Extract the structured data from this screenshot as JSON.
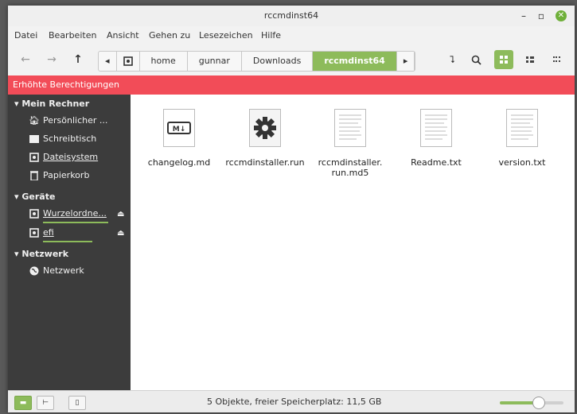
{
  "window": {
    "title": "rccmdinst64"
  },
  "menu": [
    "Datei",
    "Bearbeiten",
    "Ansicht",
    "Gehen zu",
    "Lesezeichen",
    "Hilfe"
  ],
  "breadcrumbs": [
    "home",
    "gunnar",
    "Downloads",
    "rccmdinst64"
  ],
  "banner": "Erhöhte Berechtigungen",
  "sidebar": {
    "sections": [
      {
        "title": "Mein Rechner",
        "items": [
          {
            "label": "Persönlicher ...",
            "icon": "home-icon"
          },
          {
            "label": "Schreibtisch",
            "icon": "desktop-icon"
          },
          {
            "label": "Dateisystem",
            "icon": "drive-icon"
          },
          {
            "label": "Papierkorb",
            "icon": "trash-icon"
          }
        ]
      },
      {
        "title": "Geräte",
        "items": [
          {
            "label": "Wurzelordne...",
            "icon": "drive-icon"
          },
          {
            "label": "efi",
            "icon": "drive-icon"
          }
        ]
      },
      {
        "title": "Netzwerk",
        "items": [
          {
            "label": "Netzwerk",
            "icon": "network-icon"
          }
        ]
      }
    ]
  },
  "files": [
    {
      "name": "changelog.md",
      "icon": "markdown-icon"
    },
    {
      "name": "rccmdinstaller.run",
      "icon": "gear-icon"
    },
    {
      "name": "rccmdinstaller.\nrun.md5",
      "icon": "text-file-icon"
    },
    {
      "name": "Readme.txt",
      "icon": "text-file-icon"
    },
    {
      "name": "version.txt",
      "icon": "text-file-icon"
    }
  ],
  "status": {
    "text": "5 Objekte, freier Speicherplatz: 11,5 GB",
    "zoom_fraction": 0.6
  },
  "colors": {
    "accent": "#8dbb5b",
    "banner": "#f24c58",
    "sidebar": "#3c3c3c"
  }
}
